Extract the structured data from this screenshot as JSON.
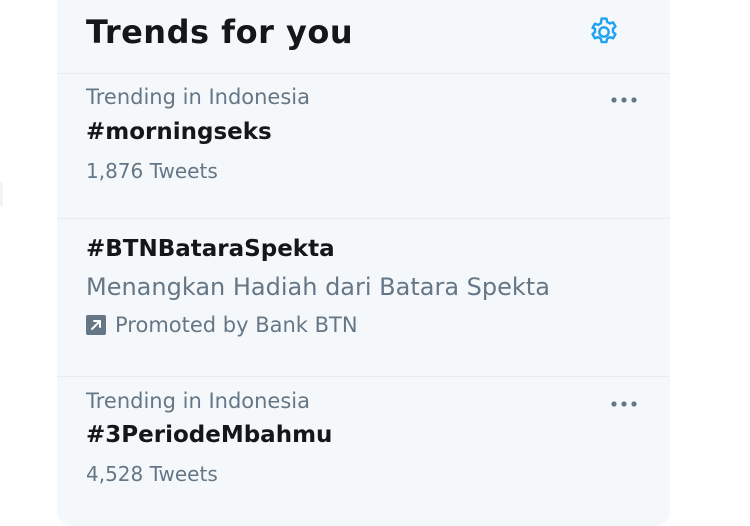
{
  "panel": {
    "title": "Trends for you",
    "settings_icon": "gear-icon",
    "accent_color": "#1da1f2"
  },
  "trends": [
    {
      "context": "Trending in Indonesia",
      "tag": "#morningseks",
      "count": "1,876 Tweets",
      "more_icon": "more-icon"
    },
    {
      "tag": "#BTNBataraSpekta",
      "description": "Menangkan Hadiah dari Batara Spekta",
      "promoted_by": "Promoted by Bank BTN",
      "promoted_icon": "promoted-icon"
    },
    {
      "context": "Trending in Indonesia",
      "tag": "#3PeriodeMbahmu",
      "count": "4,528 Tweets",
      "more_icon": "more-icon"
    }
  ]
}
